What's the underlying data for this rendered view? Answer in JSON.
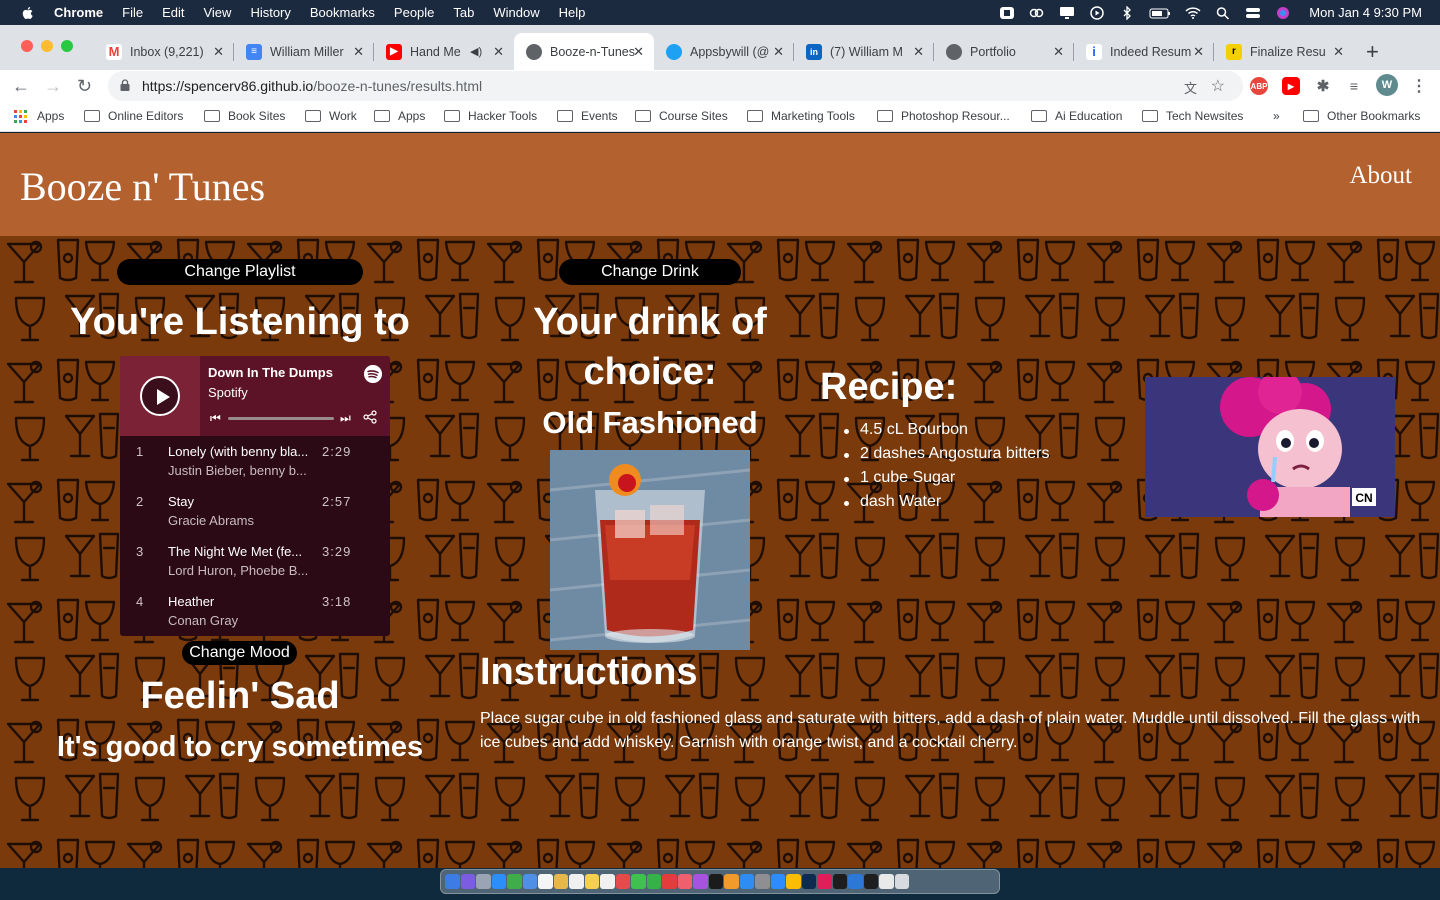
{
  "menubar": {
    "app": "Chrome",
    "items": [
      "File",
      "Edit",
      "View",
      "History",
      "Bookmarks",
      "People",
      "Tab",
      "Window",
      "Help"
    ],
    "clock": "Mon Jan 4  9:30 PM"
  },
  "tabs": [
    {
      "title": "Inbox (9,221)",
      "icon": "gmail-icon",
      "color": "#ea4335"
    },
    {
      "title": "William Miller",
      "icon": "docs-icon",
      "color": "#4285f4"
    },
    {
      "title": "Hand Me",
      "icon": "youtube-icon",
      "color": "#ff0000"
    },
    {
      "title": "Booze-n-Tunes",
      "icon": "globe-icon",
      "color": "#5f6368",
      "active": true
    },
    {
      "title": "Appsbywill (@",
      "icon": "twitter-icon",
      "color": "#1da1f2"
    },
    {
      "title": "(7) William M",
      "icon": "linkedin-icon",
      "color": "#0a66c2"
    },
    {
      "title": "Portfolio",
      "icon": "globe-icon",
      "color": "#5f6368"
    },
    {
      "title": "Indeed Resum",
      "icon": "indeed-icon",
      "color": "#2164f3"
    },
    {
      "title": "Finalize Resu",
      "icon": "resume-icon",
      "color": "#f5d000"
    }
  ],
  "toolbar": {
    "url_host": "https://spencerv86.github.io",
    "url_path": "/booze-n-tunes/results.html",
    "profile_initial": "W"
  },
  "bookmarks": [
    "Apps",
    "Online Editors",
    "Book Sites",
    "Work",
    "Apps",
    "Hacker Tools",
    "Events",
    "Course Sites",
    "Marketing Tools",
    "Photoshop Resour...",
    "Ai Education",
    "Tech Newsites",
    "»",
    "Other Bookmarks"
  ],
  "site": {
    "title": "Booze n' Tunes",
    "about": "About"
  },
  "left": {
    "change_playlist": "Change Playlist",
    "listening_heading": "You're Listening to",
    "change_mood": "Change Mood",
    "mood": "Feelin' Sad",
    "mood_tagline": "It's good to cry sometimes"
  },
  "player": {
    "playlist": "Down In The Dumps",
    "source": "Spotify",
    "tracks": [
      {
        "num": "1",
        "name": "Lonely (with benny bla...",
        "artist": "Justin Bieber, benny b...",
        "duration": "2:29"
      },
      {
        "num": "2",
        "name": "Stay",
        "artist": "Gracie Abrams",
        "duration": "2:57"
      },
      {
        "num": "3",
        "name": "The Night We Met (fe...",
        "artist": "Lord Huron, Phoebe B...",
        "duration": "3:29"
      },
      {
        "num": "4",
        "name": "Heather",
        "artist": "Conan Gray",
        "duration": "3:18"
      }
    ]
  },
  "drink": {
    "change_drink": "Change Drink",
    "heading_line1": "Your drink of",
    "heading_line2": "choice:",
    "name": "Old Fashioned",
    "recipe_heading": "Recipe:",
    "recipe": [
      "4.5 cL Bourbon",
      "2 dashes Angostura bitters",
      "1 cube Sugar",
      "dash Water"
    ],
    "instructions_heading": "Instructions",
    "instructions": "Place sugar cube in old fashioned glass and saturate with bitters, add a dash of plain water. Muddle until dissolved. Fill the glass with ice cubes and add whiskey. Garnish with orange twist, and a cocktail cherry."
  },
  "gif": {
    "badge": "CN"
  },
  "colors": {
    "header": "#b2612f",
    "page_bg": "#7a3a0c",
    "pill": "#000000"
  }
}
